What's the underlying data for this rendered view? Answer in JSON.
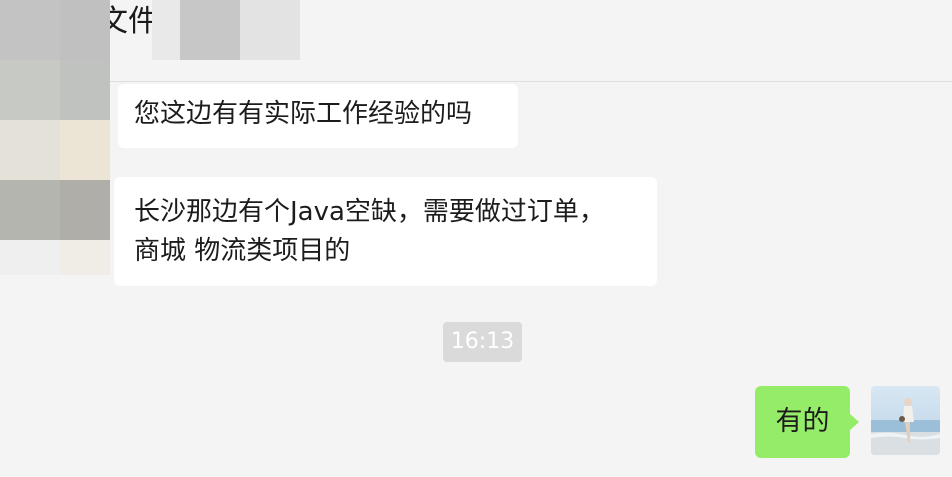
{
  "chat": {
    "title": "文件",
    "messages": [
      {
        "text": "您这边有有实际工作经验的吗"
      },
      {
        "lines": [
          "长沙那边有个Java空缺，需要做过订单，",
          "商城 物流类项目的"
        ]
      }
    ],
    "timestamp": "16:13",
    "reply": "有的"
  },
  "colors": {
    "background": "#f4f4f4",
    "incoming_bubble": "#ffffff",
    "outgoing_bubble": "#95ec69",
    "timestamp_bg": "#dadada"
  },
  "icons": {
    "contact_avatar": "pixelated-avatar",
    "user_avatar": "beach-photo-avatar"
  }
}
